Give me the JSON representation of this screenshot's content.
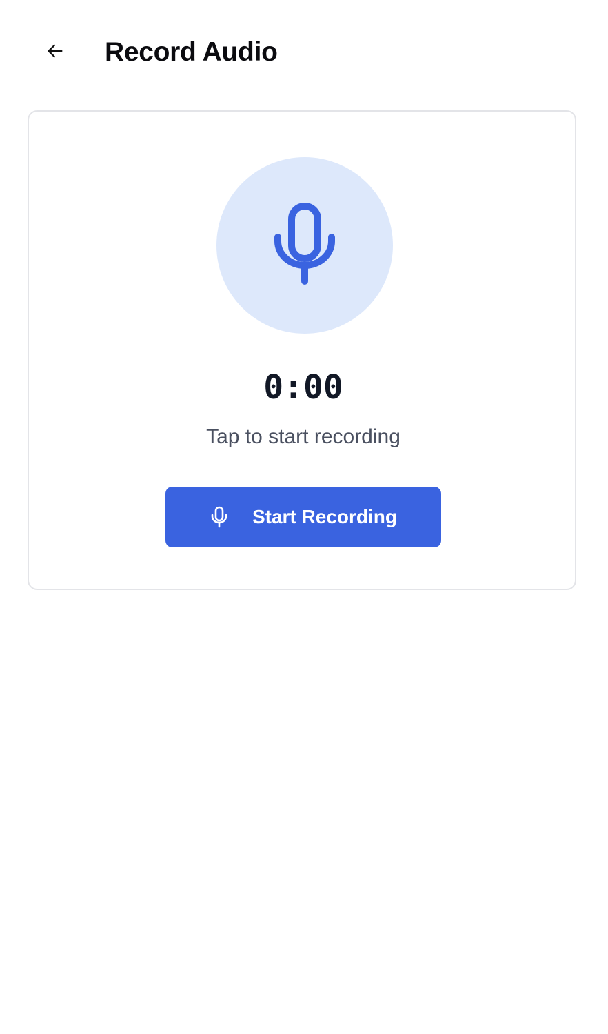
{
  "header": {
    "back_icon": "arrow-left-icon",
    "title": "Record Audio"
  },
  "recorder": {
    "mic_icon": "microphone-icon",
    "timer": "0:00",
    "hint": "Tap to start recording",
    "start_button": {
      "icon": "microphone-icon",
      "label": "Start Recording"
    }
  },
  "colors": {
    "accent": "#3A63E0",
    "mic_circle_background": "#DDE8FB",
    "card_border": "#E3E4E8",
    "title_text": "#0B0B0F",
    "timer_text": "#121826",
    "hint_text": "#4A5060"
  }
}
